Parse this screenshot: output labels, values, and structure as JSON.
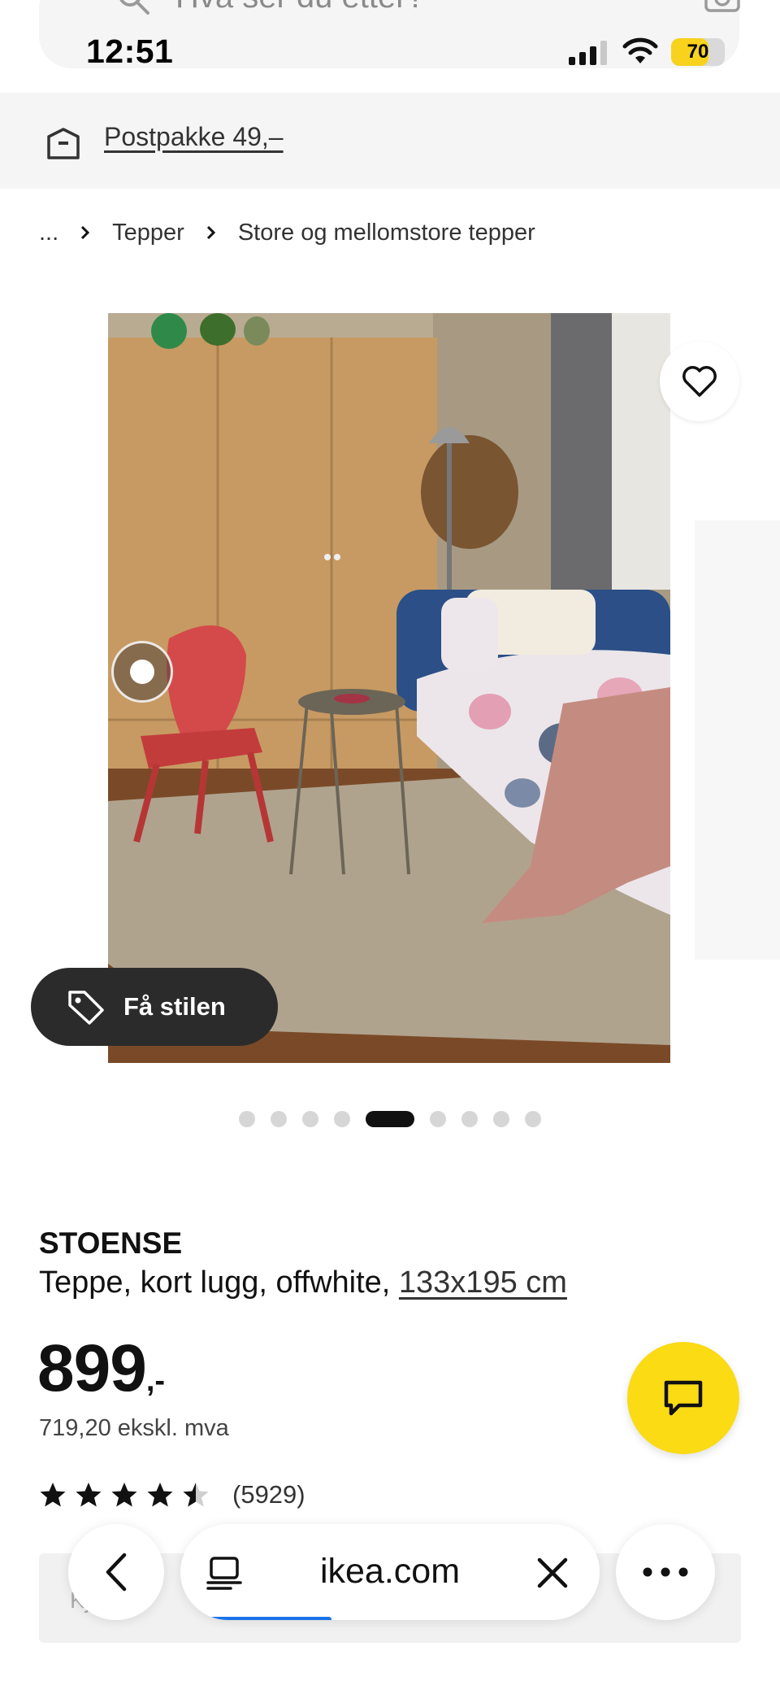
{
  "search": {
    "placeholder": "Hva ser du etter?"
  },
  "status_bar": {
    "time": "12:51",
    "battery_level": 70
  },
  "shipping": {
    "label": "Postpakke 49,–"
  },
  "breadcrumb": {
    "ellipsis": "...",
    "items": [
      "Tepper",
      "Store og mellomstore tepper"
    ]
  },
  "product_image": {
    "current_index": 5,
    "total_images": 9
  },
  "style_button": {
    "label": "Få stilen"
  },
  "product": {
    "name": "STOENSE",
    "description": "Teppe, kort lugg, offwhite, ",
    "size": "133x195 cm",
    "price": "899",
    "price_suffix": ",-",
    "price_ex_vat": "719,20 ekskl. mva",
    "rating": 4.5,
    "rating_max": 5,
    "review_count": "(5929)"
  },
  "buy_bar": {
    "label": "Kjøp"
  },
  "browser": {
    "url": "ikea.com",
    "load_progress": 0.36
  },
  "colors": {
    "chat_button": "#fadb14",
    "battery_fill": "#f8d21c",
    "progress": "#1a73e8"
  }
}
